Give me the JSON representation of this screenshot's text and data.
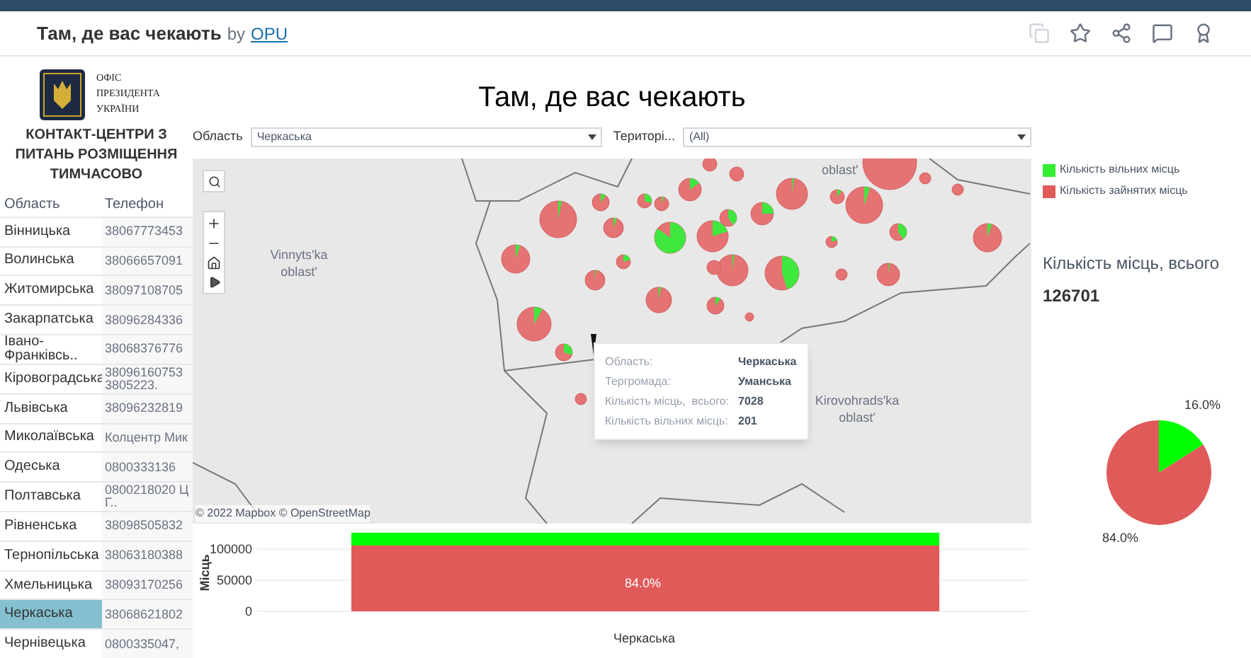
{
  "header": {
    "title": "Там, де вас чекають",
    "by": "by",
    "author": "OPU"
  },
  "logo": {
    "lines": [
      "ОФІС",
      "ПРЕЗИДЕНТА",
      "УКРАЇНИ"
    ]
  },
  "dashboard_title": "Там, де вас чекають",
  "contacts": {
    "heading": "КОНТАКТ-ЦЕНТРИ З ПИТАНЬ РОЗМІЩЕННЯ ТИМЧАСОВО",
    "columns": [
      "Область",
      "Телефон"
    ],
    "rows": [
      {
        "region": "Вінницька",
        "phone": "38067773453",
        "selected": false
      },
      {
        "region": "Волинська",
        "phone": "38066657091",
        "selected": false
      },
      {
        "region": "Житомирська",
        "phone": "38097108705",
        "selected": false
      },
      {
        "region": "Закарпатська",
        "phone": "38096284336",
        "selected": false
      },
      {
        "region": "Івано-Франківсь..",
        "phone": "38068376776",
        "selected": false
      },
      {
        "region": "Кіровоградська",
        "phone": "38096160753 3805223.",
        "selected": false
      },
      {
        "region": "Львівська",
        "phone": "38096232819",
        "selected": false
      },
      {
        "region": "Миколаївська",
        "phone": "Колцентр Мик",
        "selected": false
      },
      {
        "region": "Одеська",
        "phone": "0800333136",
        "selected": false
      },
      {
        "region": "Полтавська",
        "phone": "0800218020 Ц Г..",
        "selected": false
      },
      {
        "region": "Рівненська",
        "phone": "38098505832",
        "selected": false
      },
      {
        "region": "Тернопільська",
        "phone": "38063180388",
        "selected": false
      },
      {
        "region": "Хмельницька",
        "phone": "38093170256",
        "selected": false
      },
      {
        "region": "Черкаська",
        "phone": "38068621802",
        "selected": true
      },
      {
        "region": "Чернівецька",
        "phone": "0800335047,",
        "selected": false
      }
    ]
  },
  "filters": [
    {
      "label": "Область",
      "value": "Черкаська"
    },
    {
      "label": "Територі...",
      "value": "(All)"
    }
  ],
  "map": {
    "labels": [
      "Vinnyts'ka oblast'",
      "oblast'",
      "Kirovohrads'ka oblast'"
    ],
    "attribution": "© 2022 Mapbox © OpenStreetMap",
    "tooltip": [
      {
        "label": "Область:",
        "value": "Черкаська"
      },
      {
        "label": "Тергромада:",
        "value": "Уманська"
      },
      {
        "label": "Кількість місць,  всього:",
        "value": "7028"
      },
      {
        "label": "Кількість вільних місць:",
        "value": "201"
      }
    ]
  },
  "legend": [
    {
      "label": "Кількість вільних місць",
      "color": "#33ee33"
    },
    {
      "label": "Кількість зайнятих місць",
      "color": "#e05a5a"
    }
  ],
  "total": {
    "label": "Кількість місць,  всього",
    "value": "126701"
  },
  "bar_chart": {
    "chart_data": {
      "type": "bar",
      "ylabel": "Місць",
      "categories": [
        "Черкаська"
      ],
      "stacked": true,
      "ylim": [
        0,
        130000
      ],
      "yticks": [
        0,
        50000,
        100000
      ],
      "series": [
        {
          "color": "#e05a5a",
          "values": [
            106000
          ]
        },
        {
          "color": "#00ff00",
          "values": [
            20700
          ]
        }
      ],
      "value_labels": [
        "84.0%"
      ]
    }
  },
  "pie_chart": {
    "chart_data": {
      "type": "pie",
      "series": [
        {
          "values": [
            16.0,
            84.0
          ]
        }
      ],
      "colors": [
        "#00ff00",
        "#e05a5a"
      ],
      "value_labels": [
        "16.0%",
        "84.0%"
      ]
    }
  }
}
